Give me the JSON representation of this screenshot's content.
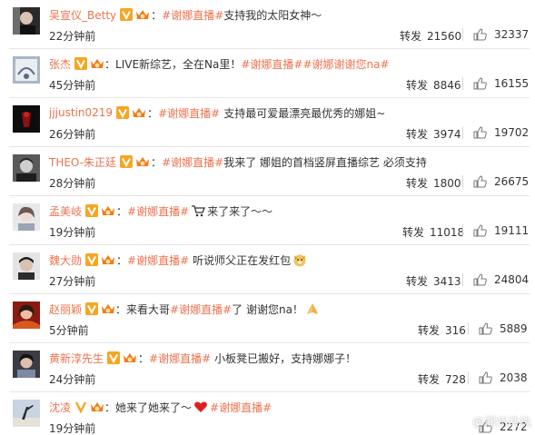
{
  "labels": {
    "repost": "转发"
  },
  "colors": {
    "username": "#eb7350",
    "hashtag": "#eb7350",
    "text": "#333333"
  },
  "icons": {
    "verified": "orange-verified-v-icon",
    "member": "crown-member-icon",
    "like": "thumbs-up-icon"
  },
  "comments": [
    {
      "user": "吴宣仪_Betty",
      "hashtag": "#谢娜直播#",
      "text_before": "",
      "text": "支持我的太阳女神～",
      "time": "22分钟前",
      "reposts": "21560",
      "likes": "32337"
    },
    {
      "user": "张杰",
      "hashtag": "#谢娜直播#",
      "text_before": "：LIVE新综艺，全在Na里！",
      "text": "#谢娜谢谢您na#",
      "time": "45分钟前",
      "reposts": "8846",
      "likes": "16155"
    },
    {
      "user": "jjjustin0219",
      "hashtag": "#谢娜直播#",
      "text_before": "",
      "text": "支持最可爱最漂亮最优秀的娜姐~",
      "time": "26分钟前",
      "reposts": "3974",
      "likes": "19702"
    },
    {
      "user": "THEO-朱正廷",
      "hashtag": "#谢娜直播#",
      "text_before": "",
      "text": "我来了 娜姐的首档竖屏直播综艺 必须支持",
      "time": "28分钟前",
      "reposts": "1800",
      "likes": "26675"
    },
    {
      "user": "孟美岐",
      "hashtag": "#谢娜直播#",
      "text_before": "",
      "text": "来了来了～～",
      "emoji": "shopping-cart-emoji",
      "time": "19分钟前",
      "reposts": "11018",
      "likes": "19111"
    },
    {
      "user": "魏大勋",
      "hashtag": "#谢娜直播#",
      "text_before": "",
      "text": "听说师父正在发红包",
      "emoji": "dog-face-emoji",
      "time": "27分钟前",
      "reposts": "3413",
      "likes": "24804"
    },
    {
      "user": "赵丽颖",
      "hashtag": "#谢娜直播#",
      "text_before": "：来看大哥",
      "text": "了 谢谢您na！",
      "emoji": "praying-hands-emoji",
      "time": "5分钟前",
      "reposts": "316",
      "likes": "5889"
    },
    {
      "user": "黄新淳先生",
      "hashtag": "#谢娜直播#",
      "text_before": "",
      "text": "小板凳已搬好，支持娜娜子！",
      "time": "24分钟前",
      "reposts": "728",
      "likes": "2038"
    },
    {
      "user": "沈凌",
      "hashtag": "#谢娜直播#",
      "text_before": "：她来了她来了～",
      "text": "",
      "emoji": "red-heart-emoji",
      "time": "19分钟前",
      "reposts": "",
      "likes": "2272"
    }
  ],
  "watermark": "@郑州共执"
}
